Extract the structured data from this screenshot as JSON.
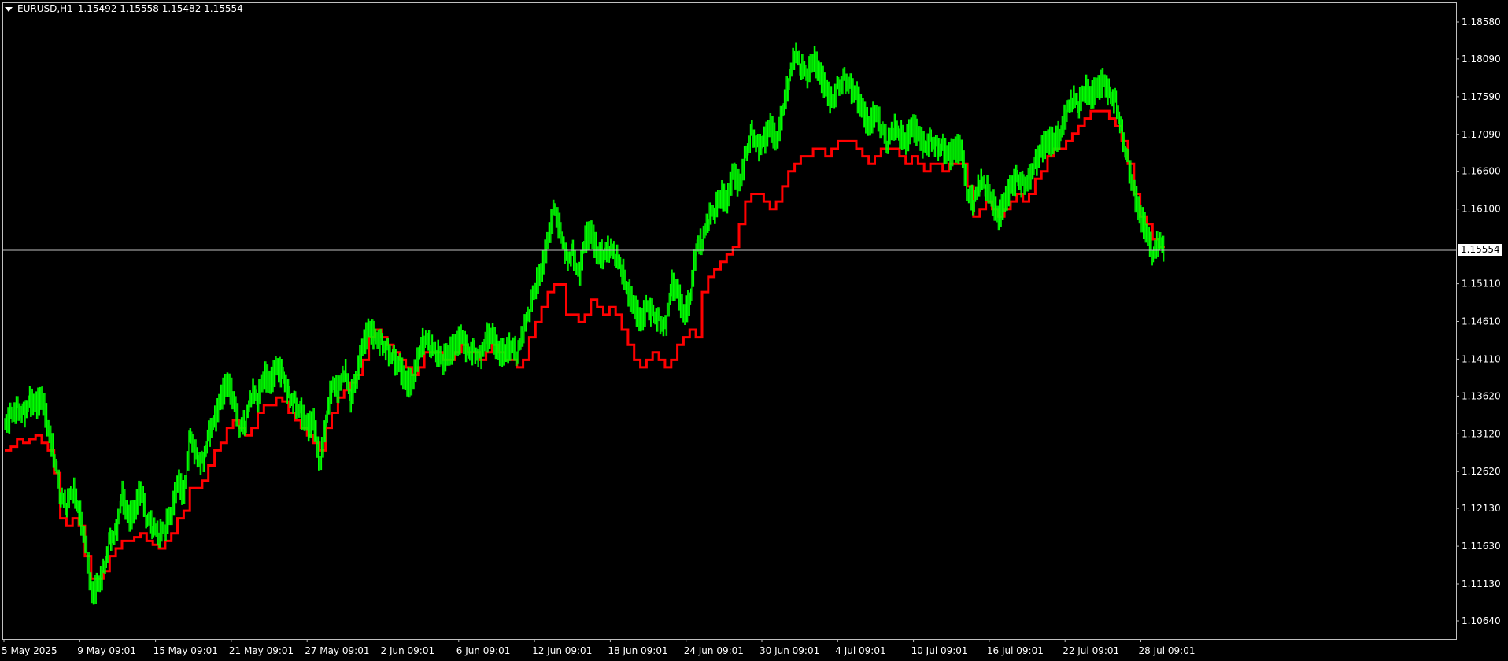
{
  "header": {
    "symbol": "EURUSD,H1",
    "ohlc": "1.15492 1.15558 1.15482 1.15554"
  },
  "current_price": "1.15554",
  "colors": {
    "background": "#000000",
    "bars": "#00ff00",
    "moving_average": "#ff0000",
    "grid_frame": "#c0c0c0",
    "price_line": "#c0c0c0"
  },
  "chart_data": {
    "type": "line",
    "ylim": [
      1.104,
      1.1883
    ],
    "y_ticks": [
      "1.18580",
      "1.18090",
      "1.17590",
      "1.17090",
      "1.16600",
      "1.16100",
      "1.15110",
      "1.14610",
      "1.14110",
      "1.13620",
      "1.13120",
      "1.12620",
      "1.12130",
      "1.11630",
      "1.11130",
      "1.10640"
    ],
    "x_ticks": [
      "5 May 2025",
      "9 May 09:01",
      "15 May 09:01",
      "21 May 09:01",
      "27 May 09:01",
      "2 Jun 09:01",
      "6 Jun 09:01",
      "12 Jun 09:01",
      "18 Jun 09:01",
      "24 Jun 09:01",
      "30 Jun 09:01",
      "4 Jul 09:01",
      "10 Jul 09:01",
      "16 Jul 09:01",
      "22 Jul 09:01",
      "28 Jul 09:01"
    ],
    "series": [
      {
        "values": [
          1.1325,
          1.1335,
          1.1345,
          1.1335,
          1.1355,
          1.135,
          1.136,
          1.132,
          1.128,
          1.123,
          1.122,
          1.124,
          1.121,
          1.117,
          1.11,
          1.111,
          1.113,
          1.117,
          1.118,
          1.123,
          1.12,
          1.121,
          1.124,
          1.12,
          1.119,
          1.118,
          1.119,
          1.121,
          1.125,
          1.123,
          1.131,
          1.128,
          1.127,
          1.131,
          1.133,
          1.136,
          1.138,
          1.136,
          1.132,
          1.133,
          1.137,
          1.136,
          1.139,
          1.138,
          1.14,
          1.139,
          1.136,
          1.135,
          1.134,
          1.132,
          1.133,
          1.127,
          1.133,
          1.138,
          1.137,
          1.14,
          1.136,
          1.139,
          1.143,
          1.145,
          1.144,
          1.143,
          1.142,
          1.141,
          1.14,
          1.138,
          1.138,
          1.142,
          1.144,
          1.143,
          1.142,
          1.141,
          1.142,
          1.143,
          1.144,
          1.142,
          1.142,
          1.141,
          1.144,
          1.144,
          1.142,
          1.142,
          1.143,
          1.142,
          1.145,
          1.148,
          1.151,
          1.153,
          1.157,
          1.161,
          1.158,
          1.154,
          1.155,
          1.152,
          1.157,
          1.158,
          1.155,
          1.155,
          1.156,
          1.155,
          1.153,
          1.15,
          1.148,
          1.146,
          1.148,
          1.147,
          1.146,
          1.145,
          1.151,
          1.15,
          1.147,
          1.149,
          1.156,
          1.157,
          1.16,
          1.161,
          1.163,
          1.162,
          1.166,
          1.164,
          1.168,
          1.171,
          1.169,
          1.17,
          1.172,
          1.17,
          1.174,
          1.178,
          1.182,
          1.18,
          1.179,
          1.181,
          1.179,
          1.177,
          1.175,
          1.177,
          1.178,
          1.177,
          1.176,
          1.174,
          1.172,
          1.174,
          1.172,
          1.17,
          1.172,
          1.171,
          1.17,
          1.172,
          1.171,
          1.169,
          1.17,
          1.169,
          1.169,
          1.168,
          1.169,
          1.169,
          1.163,
          1.162,
          1.165,
          1.164,
          1.162,
          1.16,
          1.162,
          1.164,
          1.165,
          1.164,
          1.165,
          1.167,
          1.169,
          1.17,
          1.17,
          1.171,
          1.174,
          1.176,
          1.175,
          1.177,
          1.176,
          1.177,
          1.178,
          1.176,
          1.175,
          1.171,
          1.167,
          1.163,
          1.16,
          1.158,
          1.155,
          1.157,
          1.1555
        ]
      },
      {
        "values": [
          1.129,
          1.1295,
          1.1305,
          1.13,
          1.1305,
          1.131,
          1.13,
          1.129,
          1.126,
          1.12,
          1.119,
          1.12,
          1.119,
          1.115,
          1.112,
          1.112,
          1.113,
          1.115,
          1.116,
          1.117,
          1.117,
          1.1175,
          1.118,
          1.117,
          1.1165,
          1.116,
          1.117,
          1.118,
          1.12,
          1.121,
          1.124,
          1.124,
          1.125,
          1.127,
          1.129,
          1.13,
          1.132,
          1.133,
          1.132,
          1.131,
          1.132,
          1.134,
          1.135,
          1.135,
          1.136,
          1.1355,
          1.134,
          1.133,
          1.132,
          1.131,
          1.13,
          1.129,
          1.132,
          1.134,
          1.136,
          1.137,
          1.138,
          1.139,
          1.141,
          1.144,
          1.145,
          1.144,
          1.143,
          1.142,
          1.141,
          1.14,
          1.139,
          1.14,
          1.142,
          1.142,
          1.142,
          1.141,
          1.141,
          1.142,
          1.143,
          1.142,
          1.142,
          1.141,
          1.142,
          1.143,
          1.142,
          1.141,
          1.141,
          1.14,
          1.141,
          1.144,
          1.146,
          1.148,
          1.15,
          1.151,
          1.151,
          1.147,
          1.147,
          1.146,
          1.147,
          1.149,
          1.148,
          1.147,
          1.148,
          1.147,
          1.145,
          1.143,
          1.141,
          1.14,
          1.141,
          1.142,
          1.141,
          1.14,
          1.141,
          1.143,
          1.144,
          1.145,
          1.144,
          1.15,
          1.152,
          1.153,
          1.154,
          1.155,
          1.156,
          1.159,
          1.162,
          1.163,
          1.163,
          1.162,
          1.161,
          1.162,
          1.164,
          1.166,
          1.167,
          1.168,
          1.168,
          1.169,
          1.169,
          1.168,
          1.169,
          1.17,
          1.17,
          1.17,
          1.169,
          1.168,
          1.167,
          1.168,
          1.169,
          1.169,
          1.169,
          1.168,
          1.167,
          1.168,
          1.167,
          1.166,
          1.167,
          1.167,
          1.166,
          1.167,
          1.167,
          1.167,
          1.164,
          1.16,
          1.161,
          1.162,
          1.161,
          1.16,
          1.161,
          1.162,
          1.163,
          1.162,
          1.163,
          1.165,
          1.166,
          1.168,
          1.169,
          1.169,
          1.17,
          1.171,
          1.172,
          1.173,
          1.174,
          1.174,
          1.174,
          1.173,
          1.172,
          1.17,
          1.167,
          1.163,
          1.16,
          1.159,
          1.157,
          1.156,
          1.156
        ]
      }
    ]
  }
}
